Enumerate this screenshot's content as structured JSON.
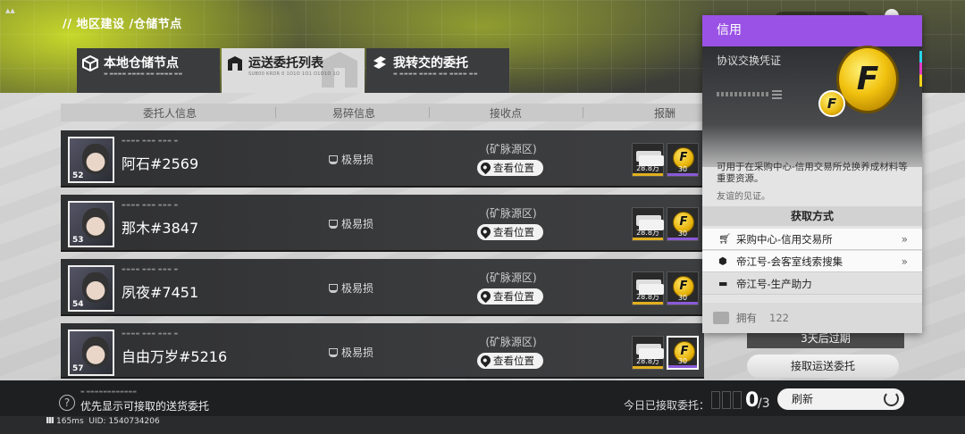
{
  "breadcrumb": "// 地区建设 /仓储节点",
  "tabs": [
    {
      "label": "本地仓储节点",
      "sub": "▬ ▬▬▬▬ ▬▬▬▬ ▬▬ ▬▬▬▬ ▬▬",
      "active": false
    },
    {
      "label": "运送委托列表",
      "sub": "SUB00 KRDR 0 1O1O 1O1 O1O1O 1O",
      "active": true
    },
    {
      "label": "我转交的委托",
      "sub": "▬ ▬▬▬▬ ▬▬▬▬ ▬▬ ▬▬▬▬ ▬▬",
      "active": false
    }
  ],
  "table": {
    "headers": [
      "委托人信息",
      "易碎信息",
      "接收点",
      "报酬"
    ],
    "rows": [
      {
        "level": "52",
        "name": "阿石#2569",
        "fragile": "极易损",
        "dest": "(矿脉源区)",
        "loc_label": "查看位置",
        "money_qty": "28.8万",
        "credit_qty": "30"
      },
      {
        "level": "53",
        "name": "那木#3847",
        "fragile": "极易损",
        "dest": "(矿脉源区)",
        "loc_label": "查看位置",
        "money_qty": "28.8万",
        "credit_qty": "30"
      },
      {
        "level": "54",
        "name": "夙夜#7451",
        "fragile": "极易损",
        "dest": "(矿脉源区)",
        "loc_label": "查看位置",
        "money_qty": "28.8万",
        "credit_qty": "30"
      },
      {
        "level": "57",
        "name": "自由万岁#5216",
        "fragile": "极易损",
        "dest": "(矿脉源区)",
        "loc_label": "查看位置",
        "money_qty": "28.8万",
        "credit_qty": "30"
      }
    ]
  },
  "side": {
    "expire": "3天后过期",
    "accept_button": "接取运送委托"
  },
  "bottom": {
    "priority_label": "优先显示可接取的送货委托",
    "accepted_label": "今日已接取委托：",
    "accepted_count": "0",
    "accepted_total": "/3",
    "refresh_label": "刷新",
    "ping": "165ms",
    "uid": "UID: 1540734206"
  },
  "popup": {
    "title": "信用",
    "subtitle": "协议交换凭证",
    "coin_glyph": "F",
    "description": "可用于在采购中心-信用交易所兑换养成材料等重要资源。",
    "flavor": "友谊的见证。",
    "source_title": "获取方式",
    "sources": [
      {
        "icon": "cart-icon",
        "label": "采购中心-信用交易所",
        "link": true
      },
      {
        "icon": "cube-icon",
        "label": "帝江号-会客室线索搜集",
        "link": true
      },
      {
        "icon": "trolley-icon",
        "label": "帝江号-生产助力",
        "link": false
      }
    ],
    "owned_label": "拥有",
    "owned_count": "122"
  },
  "colors": {
    "accent_purple": "#9a52e6",
    "money_bar": "#e0b020",
    "credit_bar": "#8a5ad8"
  }
}
